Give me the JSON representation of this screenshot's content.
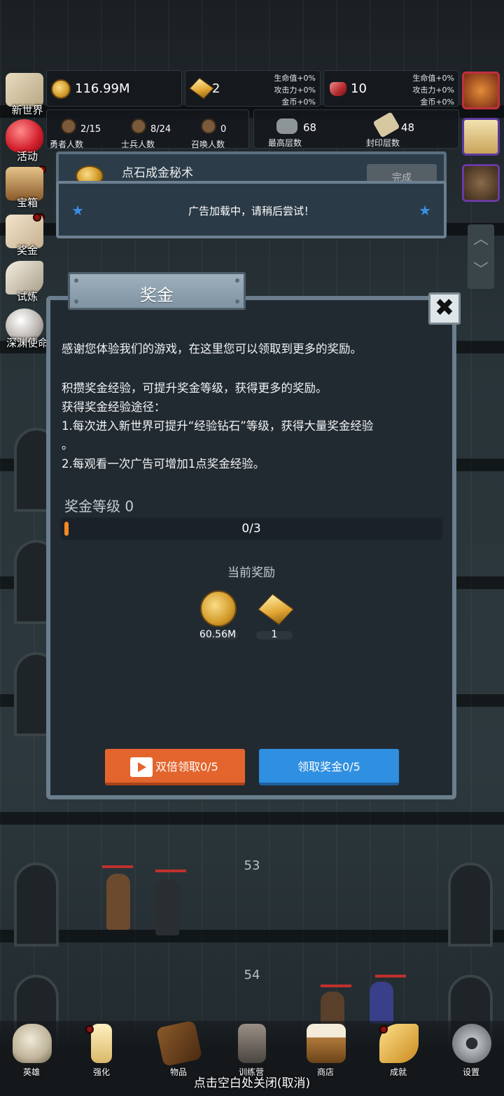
{
  "top_stats": {
    "gold": "116.99M",
    "gold_bonus": [
      "生命值+0%",
      "攻击力+0%",
      "金币+0%"
    ],
    "bars": "2",
    "gems": "10",
    "gem_bonus": [
      "生命值+0%",
      "攻击力+0%",
      "金币+0%"
    ],
    "heroes": {
      "value": "2/15",
      "label": "勇者人数"
    },
    "soldiers": {
      "value": "8/24",
      "label": "士兵人数"
    },
    "summons": {
      "value": "0",
      "label": "召唤人数"
    },
    "max_floor": {
      "value": "68",
      "label": "最高层数"
    },
    "sealed_floor": {
      "value": "48",
      "label": "封印层数"
    }
  },
  "left_menu": [
    {
      "label": "新世界",
      "icon": "map-scroll-icon",
      "dot": false
    },
    {
      "label": "活动",
      "icon": "heart-icon",
      "dot": true
    },
    {
      "label": "宝箱",
      "icon": "treasure-chest-icon",
      "dot": true
    },
    {
      "label": "奖金",
      "icon": "envelope-icon",
      "dot": false
    },
    {
      "label": "试炼",
      "icon": "feather-icon",
      "dot": false
    },
    {
      "label": "深渊使命",
      "icon": "orb-icon",
      "dot": false
    }
  ],
  "background_panel": {
    "title": "点石成金秘术",
    "button": "完成"
  },
  "toast": {
    "text": "广告加载中，请稍后尝试！"
  },
  "dialog": {
    "title": "奖金",
    "lines": [
      "感谢您体验我们的游戏，在这里您可以领取到更多的奖励。",
      "积攒奖金经验，可提升奖金等级，获得更多的奖励。",
      "获得奖金经验途径：",
      "1.每次进入新世界可提升“经验钻石”等级，获得大量奖金经验",
      "。",
      "2.每观看一次广告可增加1点奖金经验。"
    ],
    "level_label": "奖金等级 0",
    "progress_text": "0/3",
    "progress_fraction": 0,
    "reward_title": "当前奖励",
    "rewards": [
      {
        "icon": "gold-coin-icon",
        "amount": "60.56M"
      },
      {
        "icon": "gold-bar-icon",
        "amount": "1"
      }
    ],
    "double_button": "双倍领取0/5",
    "claim_button": "领取奖金0/5"
  },
  "floors": [
    "53",
    "54"
  ],
  "bottom_nav": [
    {
      "label": "英雄",
      "icon": "skull-icon",
      "dot": false
    },
    {
      "label": "强化",
      "icon": "candle-icon",
      "dot": true
    },
    {
      "label": "物品",
      "icon": "book-icon",
      "dot": false
    },
    {
      "label": "训练营",
      "icon": "lantern-icon",
      "dot": false
    },
    {
      "label": "商店",
      "icon": "beer-mug-icon",
      "dot": false
    },
    {
      "label": "成就",
      "icon": "key-icon",
      "dot": true
    },
    {
      "label": "设置",
      "icon": "gear-icon",
      "dot": false
    }
  ],
  "close_hint": "点击空白处关闭(取消)"
}
